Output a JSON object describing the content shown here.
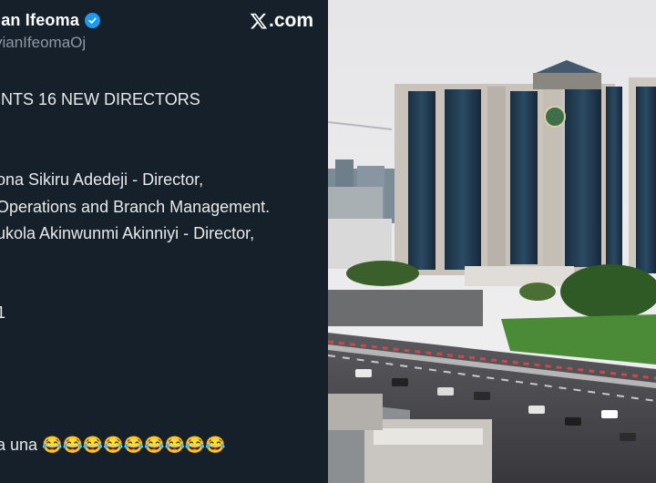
{
  "tweet": {
    "display_name": "ian Ifeoma",
    "handle": "vianIfeomaOj",
    "brand": ".com",
    "brand_icon": "x-logo-icon",
    "verified_icon": "verified-badge-icon",
    "lines": [
      "INTS 16 NEW DIRECTORS",
      "ona Sikiru Adedeji - Director,",
      "Operations and Branch Management.",
      "ukola Akinwunmi Akinniyi - Director,",
      "1",
      "a una 😂😂😂😂😂😂😂😂😂"
    ]
  },
  "colors": {
    "tweet_bg": "#16202b",
    "text": "#e7e9ea",
    "handle": "#8b98a5",
    "verified": "#1d9bf0",
    "sky": "#e9e9ea",
    "tower_glass": "#1f3a4f",
    "grass": "#3f7a2f"
  },
  "photo": {
    "subject": "office-tower-photo"
  }
}
